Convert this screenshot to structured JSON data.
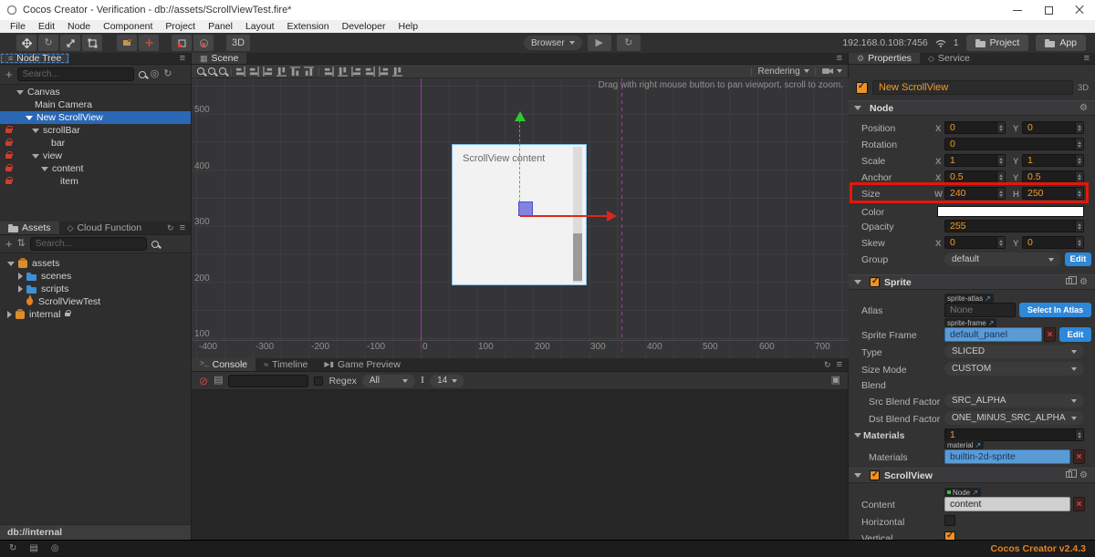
{
  "window": {
    "title": "Cocos Creator - Verification - db://assets/ScrollViewTest.fire*"
  },
  "menu": {
    "items": [
      "File",
      "Edit",
      "Node",
      "Component",
      "Project",
      "Panel",
      "Layout",
      "Extension",
      "Developer",
      "Help"
    ]
  },
  "toolbar": {
    "mode_3d": "3D",
    "preview_target": "Browser",
    "address": "192.168.0.108:7456",
    "device_count": "1",
    "project_button": "Project",
    "app_button": "App"
  },
  "node_tree": {
    "tab": "Node Tree",
    "search_placeholder": "Search...",
    "items": [
      {
        "label": "Canvas"
      },
      {
        "label": "Main Camera"
      },
      {
        "label": "New ScrollView"
      },
      {
        "label": "scrollBar"
      },
      {
        "label": "bar"
      },
      {
        "label": "view"
      },
      {
        "label": "content"
      },
      {
        "label": "item"
      }
    ]
  },
  "assets": {
    "tab_assets": "Assets",
    "tab_cloud": "Cloud Function",
    "search_placeholder": "Search...",
    "items": [
      {
        "label": "assets"
      },
      {
        "label": "scenes"
      },
      {
        "label": "scripts"
      },
      {
        "label": "ScrollViewTest"
      },
      {
        "label": "internal"
      }
    ],
    "footer": "db://internal"
  },
  "scene": {
    "tab": "Scene",
    "rendering_label": "Rendering",
    "hint": "Drag with right mouse button to pan viewport, scroll to zoom.",
    "content_label": "ScrollView content",
    "ruler_y": [
      "500",
      "400",
      "300",
      "200",
      "100"
    ],
    "ruler_x": [
      "-400",
      "-300",
      "-200",
      "-100",
      "0",
      "100",
      "200",
      "300",
      "400",
      "500",
      "600",
      "700"
    ]
  },
  "console": {
    "tab_console": "Console",
    "tab_timeline": "Timeline",
    "tab_preview": "Game Preview",
    "regex_label": "Regex",
    "filter_value": "All",
    "font_size": "14"
  },
  "properties": {
    "tab_properties": "Properties",
    "tab_service": "Service",
    "node_name": "New ScrollView",
    "badge_3d": "3D",
    "node_section": "Node",
    "axis": {
      "x": "X",
      "y": "Y",
      "w": "W",
      "h": "H"
    },
    "rows": {
      "position": {
        "label": "Position",
        "x": "0",
        "y": "0"
      },
      "rotation": {
        "label": "Rotation",
        "value": "0"
      },
      "scale": {
        "label": "Scale",
        "x": "1",
        "y": "1"
      },
      "anchor": {
        "label": "Anchor",
        "x": "0.5",
        "y": "0.5"
      },
      "size": {
        "label": "Size",
        "w": "240",
        "h": "250"
      },
      "color": {
        "label": "Color"
      },
      "opacity": {
        "label": "Opacity",
        "value": "255"
      },
      "skew": {
        "label": "Skew",
        "x": "0",
        "y": "0"
      },
      "group": {
        "label": "Group",
        "value": "default",
        "edit": "Edit"
      }
    },
    "sprite": {
      "section": "Sprite",
      "atlas_label": "Atlas",
      "atlas_tag": "sprite-atlas",
      "atlas_value": "None",
      "atlas_button": "Select In Atlas",
      "frame_label": "Sprite Frame",
      "frame_tag": "sprite-frame",
      "frame_value": "default_panel",
      "edit_button": "Edit",
      "type_label": "Type",
      "type_value": "SLICED",
      "sizemode_label": "Size Mode",
      "sizemode_value": "CUSTOM",
      "blend_label": "Blend",
      "src_label": "Src Blend Factor",
      "src_value": "SRC_ALPHA",
      "dst_label": "Dst Blend Factor",
      "dst_value": "ONE_MINUS_SRC_ALPHA",
      "materials_section": "Materials",
      "materials_count": "1",
      "material_tag": "material",
      "materials_label": "Materials",
      "materials_value": "builtin-2d-sprite"
    },
    "scrollview": {
      "section": "ScrollView",
      "node_tag": "Node",
      "content_label": "Content",
      "content_value": "content",
      "horizontal_label": "Horizontal",
      "vertical_label": "Vertical"
    }
  },
  "statusbar": {
    "version": "Cocos Creator v2.4.3"
  }
}
